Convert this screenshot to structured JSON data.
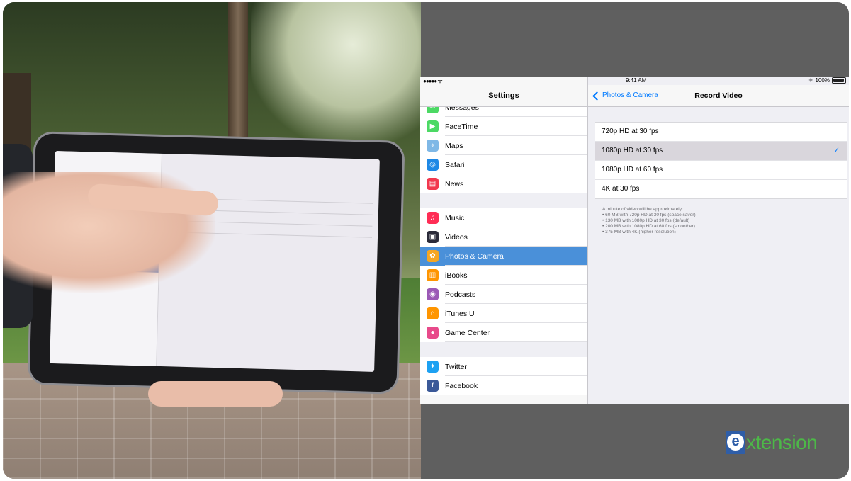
{
  "statusbar": {
    "signal": "●●●●● ᯤ",
    "time": "9:41 AM",
    "battery": "100%"
  },
  "master": {
    "title": "Settings",
    "groups": [
      [
        {
          "label": "Messages",
          "icon": "messages-icon",
          "color": "#4cd964",
          "selected": false
        },
        {
          "label": "FaceTime",
          "icon": "facetime-icon",
          "color": "#4cd964",
          "selected": false
        },
        {
          "label": "Maps",
          "icon": "maps-icon",
          "color": "#7fb8e6",
          "selected": false
        },
        {
          "label": "Safari",
          "icon": "safari-icon",
          "color": "#1e88e5",
          "selected": false
        },
        {
          "label": "News",
          "icon": "news-icon",
          "color": "#f2384e",
          "selected": false
        }
      ],
      [
        {
          "label": "Music",
          "icon": "music-icon",
          "color": "#ff2d55",
          "selected": false
        },
        {
          "label": "Videos",
          "icon": "videos-icon",
          "color": "#2b2b3a",
          "selected": false
        },
        {
          "label": "Photos & Camera",
          "icon": "photos-icon",
          "color": "#f5a623",
          "selected": true
        },
        {
          "label": "iBooks",
          "icon": "ibooks-icon",
          "color": "#ff9500",
          "selected": false
        },
        {
          "label": "Podcasts",
          "icon": "podcasts-icon",
          "color": "#9b59b6",
          "selected": false
        },
        {
          "label": "iTunes U",
          "icon": "itunes-u-icon",
          "color": "#ff9500",
          "selected": false
        },
        {
          "label": "Game Center",
          "icon": "game-center-icon",
          "color": "#e84a8a",
          "selected": false
        }
      ],
      [
        {
          "label": "Twitter",
          "icon": "twitter-icon",
          "color": "#1da1f2",
          "selected": false
        },
        {
          "label": "Facebook",
          "icon": "facebook-icon",
          "color": "#3b5998",
          "selected": false
        }
      ]
    ]
  },
  "detail": {
    "back_label": "Photos & Camera",
    "title": "Record Video",
    "options": [
      {
        "label": "720p HD at 30 fps",
        "checked": false
      },
      {
        "label": "1080p HD at 30 fps",
        "checked": true
      },
      {
        "label": "1080p HD at 60 fps",
        "checked": false
      },
      {
        "label": "4K at 30 fps",
        "checked": false
      }
    ],
    "footnote": [
      "A minute of video will be approximately:",
      "• 60 MB with 720p HD at 30 fps (space saver)",
      "• 130 MB with 1080p HD at 30 fps (default)",
      "• 200 MB with 1080p HD at 60 fps (smoother)",
      "• 375 MB with 4K (higher resolution)"
    ]
  },
  "brand": {
    "mark": "e",
    "text": "xtension",
    "text_color": "#4db848",
    "mark_color": "#2f5ea8"
  },
  "accent": "#007aff",
  "selection_color": "#4a90d9"
}
